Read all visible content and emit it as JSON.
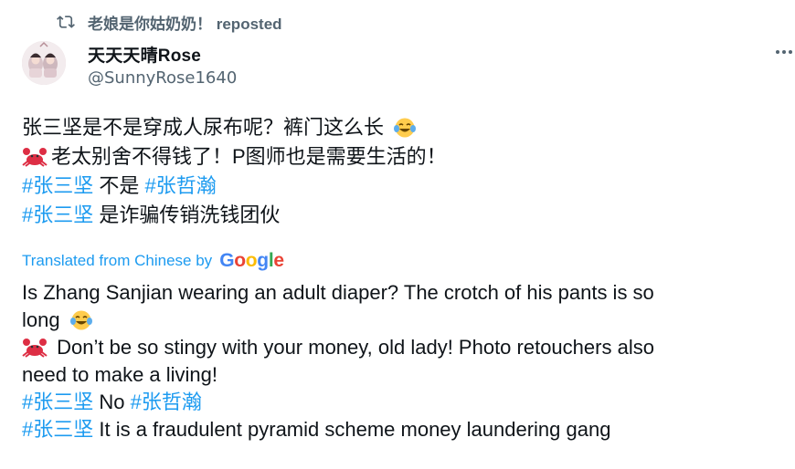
{
  "repost": {
    "icon": "repost-icon",
    "reposted_by": "老娘是你姑奶奶！",
    "label": "reposted"
  },
  "author": {
    "display_name": "天天天晴Rose",
    "handle": "@SunnyRose1640"
  },
  "tweet_zh": {
    "line1": "张三坚是不是穿成人尿布呢？裤门这么长",
    "line2": "老太别舍不得钱了！P图师也是需要生活的！",
    "line3_tag1": "#张三坚",
    "line3_mid": " 不是 ",
    "line3_tag2": "#张哲瀚",
    "line4_tag": "#张三坚",
    "line4_rest": " 是诈骗传销洗钱团伙"
  },
  "translation": {
    "label": "Translated from Chinese by",
    "provider": "Google",
    "line1": "Is Zhang Sanjian wearing an adult diaper? The crotch of his pants is so",
    "line2": "long",
    "line3": " Don’t be so stingy with your money, old lady! Photo retouchers also",
    "line4": "need to make a living!",
    "line5_tag1": "#张三坚",
    "line5_mid": " No ",
    "line5_tag2": "#张哲瀚",
    "line6_tag": "#张三坚",
    "line6_rest": " It is a fraudulent pyramid scheme money laundering gang"
  },
  "icons": {
    "laugh_emoji": "tears-of-joy-emoji",
    "crab_emoji": "crab-emoji",
    "more": "more-options-icon"
  },
  "colors": {
    "hashtag": "#1d9bf0",
    "secondary_text": "#536471",
    "primary_text": "#0f1419"
  }
}
